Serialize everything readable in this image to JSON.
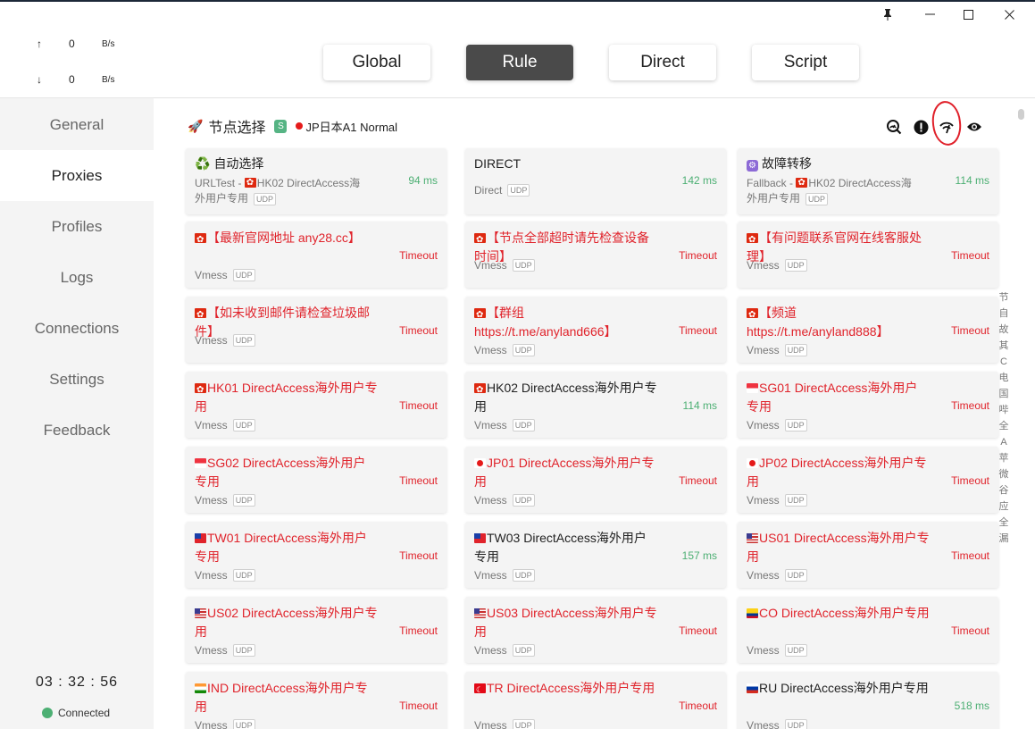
{
  "window": {
    "controls": {
      "pin": "📌",
      "minimize": "—",
      "maximize": "☐",
      "close": "✕"
    }
  },
  "traffic": {
    "up": {
      "arrow": "↑",
      "value": "0",
      "unit": "B/s"
    },
    "down": {
      "arrow": "↓",
      "value": "0",
      "unit": "B/s"
    }
  },
  "nav": [
    {
      "label": "General"
    },
    {
      "label": "Proxies"
    },
    {
      "label": "Profiles"
    },
    {
      "label": "Logs"
    },
    {
      "label": "Connections"
    },
    {
      "label": "Settings"
    },
    {
      "label": "Feedback"
    }
  ],
  "clock": "03 : 32 : 56",
  "status": "Connected",
  "modes": [
    {
      "label": "Global"
    },
    {
      "label": "Rule"
    },
    {
      "label": "Direct"
    },
    {
      "label": "Script"
    }
  ],
  "active_mode": "Rule",
  "active_nav": "Proxies",
  "group": {
    "icon": "🚀",
    "name": "节点选择",
    "type_badge": "S",
    "current": "JP日本A1 Normal"
  },
  "tool_icons": [
    "search-speed-icon",
    "alert-icon",
    "latency-test-icon",
    "visibility-icon"
  ],
  "colors": {
    "delay_ok": "#4caf73",
    "timeout": "#e0232b",
    "active_mode_bg": "#4a4a4a",
    "connected": "#4caf73",
    "annotation_circle": "#e0202a"
  },
  "proxies": [
    {
      "name": "自动选择",
      "icon": "♻️",
      "type": "URLTest - ",
      "sub_flag": "hk",
      "sub": "HK02 DirectAccess海外用户专用",
      "udp": "UDP",
      "delay": "94 ms",
      "red": false
    },
    {
      "name": "DIRECT",
      "type": "Direct",
      "udp": "UDP",
      "delay": "142 ms",
      "red": false
    },
    {
      "name": "故障转移",
      "icon": "⚙",
      "type": "Fallback - ",
      "sub_flag": "hk",
      "sub": "HK02 DirectAccess海外用户专用",
      "udp": "UDP",
      "delay": "114 ms",
      "red": false
    },
    {
      "flag": "hk",
      "name": "【最新官网地址 any28.cc】",
      "type": "Vmess",
      "udp": "UDP",
      "delay": "Timeout",
      "red": true
    },
    {
      "flag": "hk",
      "name": "【节点全部超时请先检查设备时间】",
      "type": "Vmess",
      "udp": "UDP",
      "delay": "Timeout",
      "red": true
    },
    {
      "flag": "hk",
      "name": "【有问题联系官网在线客服处理】",
      "type": "Vmess",
      "udp": "UDP",
      "delay": "Timeout",
      "red": true
    },
    {
      "flag": "hk",
      "name": "【如未收到邮件请检查垃圾邮件】",
      "type": "Vmess",
      "udp": "UDP",
      "delay": "Timeout",
      "red": true
    },
    {
      "flag": "hk",
      "name": "【群组 https://t.me/anyland666】",
      "type": "Vmess",
      "udp": "UDP",
      "delay": "Timeout",
      "red": true
    },
    {
      "flag": "hk",
      "name": "【频道 https://t.me/anyland888】",
      "type": "Vmess",
      "udp": "UDP",
      "delay": "Timeout",
      "red": true
    },
    {
      "flag": "hk",
      "name": "HK01 DirectAccess海外用户专用",
      "type": "Vmess",
      "udp": "UDP",
      "delay": "Timeout",
      "red": true
    },
    {
      "flag": "hk",
      "name": "HK02 DirectAccess海外用户专用",
      "type": "Vmess",
      "udp": "UDP",
      "delay": "114 ms",
      "red": false
    },
    {
      "flag": "sg",
      "name": "SG01 DirectAccess海外用户专用",
      "type": "Vmess",
      "udp": "UDP",
      "delay": "Timeout",
      "red": true
    },
    {
      "flag": "sg",
      "name": "SG02 DirectAccess海外用户专用",
      "type": "Vmess",
      "udp": "UDP",
      "delay": "Timeout",
      "red": true
    },
    {
      "flag": "jp",
      "name": "JP01 DirectAccess海外用户专用",
      "type": "Vmess",
      "udp": "UDP",
      "delay": "Timeout",
      "red": true
    },
    {
      "flag": "jp",
      "name": "JP02 DirectAccess海外用户专用",
      "type": "Vmess",
      "udp": "UDP",
      "delay": "Timeout",
      "red": true
    },
    {
      "flag": "tw",
      "name": "TW01 DirectAccess海外用户专用",
      "type": "Vmess",
      "udp": "UDP",
      "delay": "Timeout",
      "red": true
    },
    {
      "flag": "tw",
      "name": "TW03 DirectAccess海外用户专用",
      "type": "Vmess",
      "udp": "UDP",
      "delay": "157 ms",
      "red": false
    },
    {
      "flag": "us",
      "name": "US01 DirectAccess海外用户专用",
      "type": "Vmess",
      "udp": "UDP",
      "delay": "Timeout",
      "red": true
    },
    {
      "flag": "us",
      "name": "US02 DirectAccess海外用户专用",
      "type": "Vmess",
      "udp": "UDP",
      "delay": "Timeout",
      "red": true
    },
    {
      "flag": "us",
      "name": "US03 DirectAccess海外用户专用",
      "type": "Vmess",
      "udp": "UDP",
      "delay": "Timeout",
      "red": true
    },
    {
      "flag": "co",
      "name": "CO DirectAccess海外用户专用",
      "type": "Vmess",
      "udp": "UDP",
      "delay": "Timeout",
      "red": true
    },
    {
      "flag": "in",
      "name": "IND DirectAccess海外用户专用",
      "type": "Vmess",
      "udp": "UDP",
      "delay": "Timeout",
      "red": true
    },
    {
      "flag": "tr",
      "name": "TR DirectAccess海外用户专用",
      "type": "Vmess",
      "udp": "UDP",
      "delay": "Timeout",
      "red": true
    },
    {
      "flag": "ru",
      "name": "RU DirectAccess海外用户专用",
      "type": "Vmess",
      "udp": "UDP",
      "delay": "518 ms",
      "red": false
    }
  ],
  "index_bar": [
    "节",
    "自",
    "故",
    "其",
    "C",
    "电",
    "国",
    "哔",
    "全",
    "A",
    "苹",
    "微",
    "谷",
    "应",
    "全",
    "漏"
  ]
}
